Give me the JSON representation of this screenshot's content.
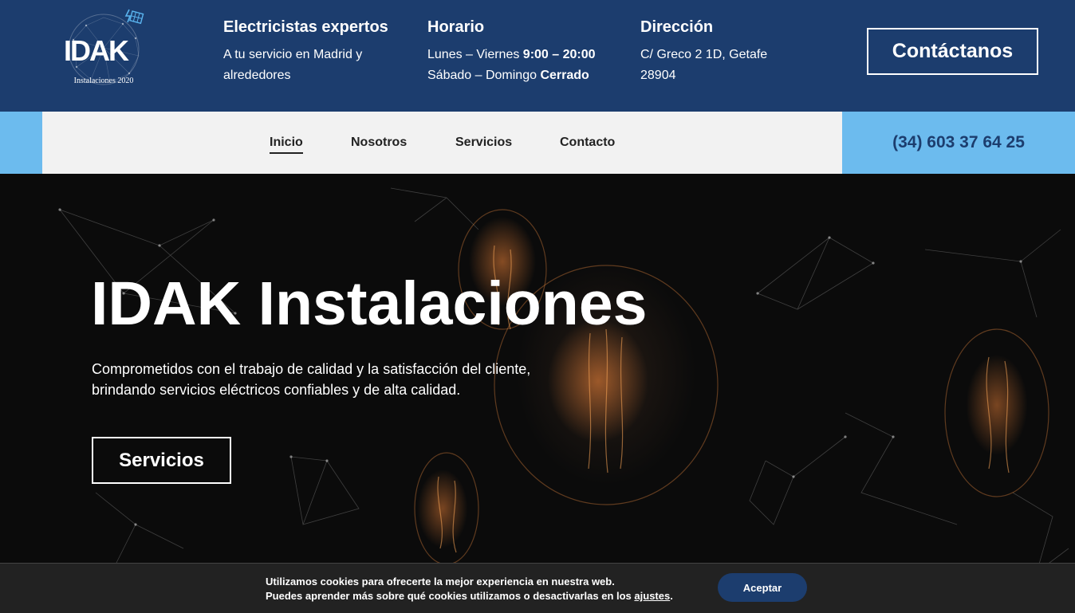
{
  "logo": {
    "letters": "IDAK",
    "tagline": "Instalaciones 2020"
  },
  "header": {
    "col1": {
      "title": "Electricistas expertos",
      "line1": "A tu servicio en Madrid y",
      "line2": "alrededores"
    },
    "col2": {
      "title": "Horario",
      "line1_label": "Lunes – Viernes",
      "line1_value": "9:00 – 20:00",
      "line2_label": "Sábado – Domingo",
      "line2_value": "Cerrado"
    },
    "col3": {
      "title": "Dirección",
      "line1": "C/ Greco 2 1D, Getafe",
      "line2": "28904"
    },
    "contact_label": "Contáctanos"
  },
  "nav": {
    "items": [
      {
        "label": "Inicio",
        "active": true
      },
      {
        "label": "Nosotros",
        "active": false
      },
      {
        "label": "Servicios",
        "active": false
      },
      {
        "label": "Contacto",
        "active": false
      }
    ],
    "phone": "(34) 603 37 64 25"
  },
  "hero": {
    "title": "IDAK Instalaciones",
    "subtitle_line1": "Comprometidos con el trabajo de calidad y la satisfacción del cliente,",
    "subtitle_line2": "brindando servicios eléctricos confiables y de alta calidad.",
    "button_label": "Servicios"
  },
  "cookie": {
    "line1": "Utilizamos cookies para ofrecerte la mejor experiencia en nuestra web.",
    "line2_prefix": "Puedes aprender más sobre qué cookies utilizamos o desactivarlas en los",
    "line2_link": "ajustes",
    "line2_suffix": ".",
    "accept_label": "Aceptar"
  },
  "colors": {
    "primary": "#1c3d6e",
    "accent": "#6cbbee",
    "nav_bg": "#f2f2f2",
    "cookie_bg": "#222222"
  }
}
